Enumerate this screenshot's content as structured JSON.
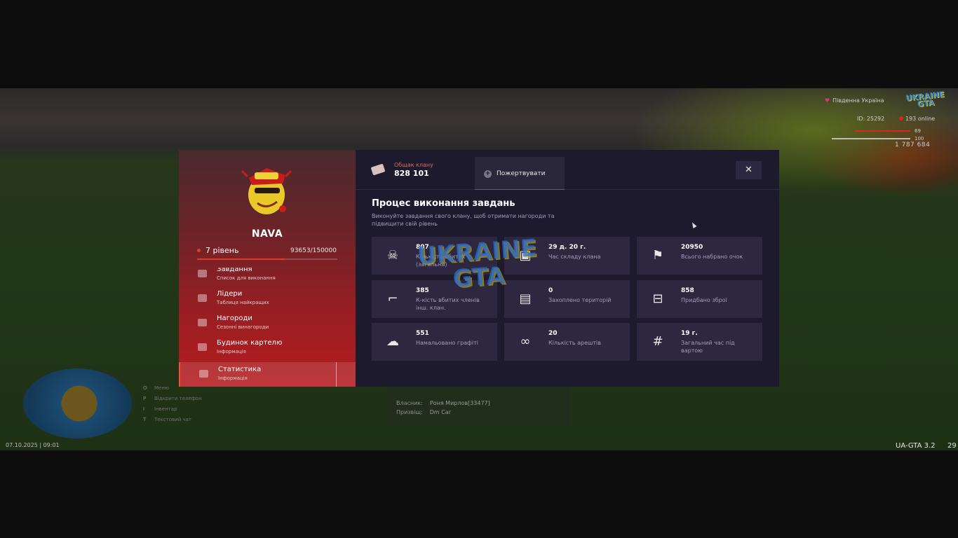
{
  "hud": {
    "region": "Південна Україна",
    "logo_line1": "UKRAINE",
    "logo_line2": "GTA",
    "player_id": "ID: 25292",
    "online": "193 online",
    "hp": "69",
    "armor": "100",
    "money": "1 787 684",
    "datetime": "07.10.2025 | 09:01",
    "version": "UA-GTA 3.2",
    "version_suffix": "29"
  },
  "bottom_menu": [
    {
      "key": "O",
      "label": "Меню"
    },
    {
      "key": "P",
      "label": "Відкрити телефон"
    },
    {
      "key": "I",
      "label": "Інвентар"
    },
    {
      "key": "T",
      "label": "Текстовий чат"
    }
  ],
  "info_box": {
    "row1_label": "Власник:",
    "row1_value": "Роня Мирлов[33477]",
    "row2_label": "Призвіщ:",
    "row2_value": "Dm Car"
  },
  "clan": {
    "name": "NAVA",
    "level_label": "7 рівень",
    "xp_text": "93653/150000",
    "xp_fraction": 0.624
  },
  "menu": [
    {
      "title": "Завдання",
      "subtitle": "Список для виконання"
    },
    {
      "title": "Лідери",
      "subtitle": "Таблиця найкращих"
    },
    {
      "title": "Нагороди",
      "subtitle": "Сезонні винагороди"
    },
    {
      "title": "Будинок картелю",
      "subtitle": "Інформація"
    },
    {
      "title": "Статистика",
      "subtitle": "Інформація",
      "active": true
    }
  ],
  "topbar": {
    "cash_label": "Общак клану",
    "cash_value": "828 101",
    "donate_label": "Пожертвувати",
    "close_symbol": "✕"
  },
  "section": {
    "title": "Процес виконання завдань",
    "description": "Виконуйте завдання свого клану, щоб отримати нагороди та підвищити свій рівень"
  },
  "stats": [
    {
      "icon": "skull-icon",
      "value": "807",
      "label": "Кількість вбитих (загальна)"
    },
    {
      "icon": "box-icon",
      "value": "29 д. 20 г.",
      "label": "Час складу клана"
    },
    {
      "icon": "flag-icon",
      "value": "20950",
      "label": "Всього набрано очок"
    },
    {
      "icon": "rifle-icon",
      "value": "385",
      "label": "К-кість вбитих членів інш. клан."
    },
    {
      "icon": "map-icon",
      "value": "0",
      "label": "Захоплено територій"
    },
    {
      "icon": "basket-icon",
      "value": "858",
      "label": "Придбано зброї"
    },
    {
      "icon": "spray-icon",
      "value": "551",
      "label": "Намальовано графіті"
    },
    {
      "icon": "handcuffs-icon",
      "value": "20",
      "label": "Кількість арештів"
    },
    {
      "icon": "fence-icon",
      "value": "19 г.",
      "label": "Загальний час під вартою"
    }
  ],
  "watermark": {
    "line1": "UKRAINE",
    "line2": "GTA"
  }
}
